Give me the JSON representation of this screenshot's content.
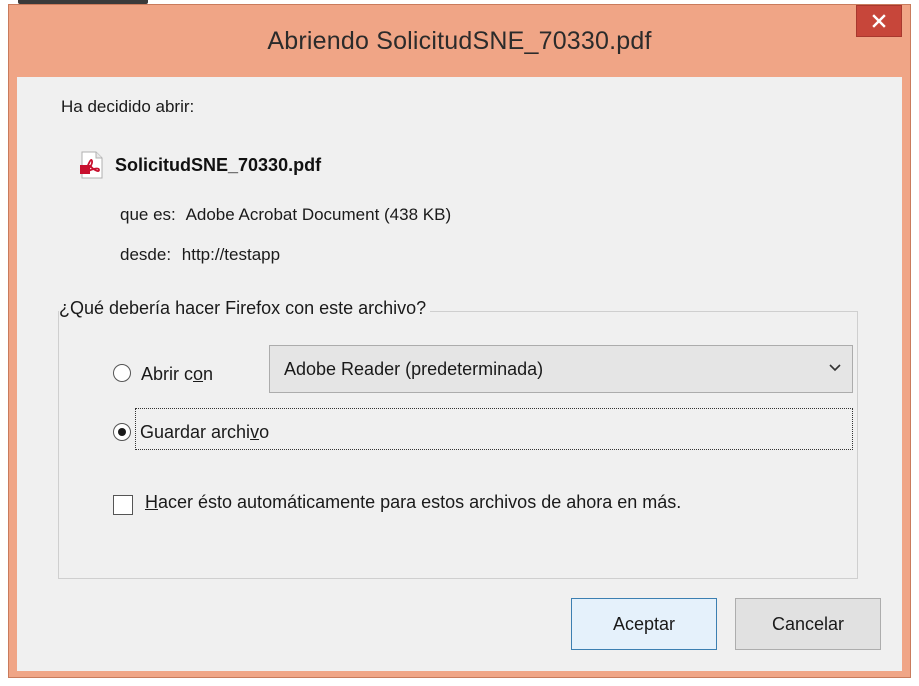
{
  "dialog": {
    "title": "Abriendo SolicitudSNE_70330.pdf",
    "close_label": "×"
  },
  "intro": {
    "decided_text": "Ha decidido abrir:"
  },
  "file": {
    "name": "SolicitudSNE_70330.pdf",
    "type_key": "que es:",
    "type_value": "Adobe Acrobat Document (438 KB)",
    "from_key": "desde:",
    "from_value": "http://testapp",
    "icon": "pdf-file-icon"
  },
  "action_group": {
    "legend": "¿Qué debería hacer Firefox con este archivo?",
    "open_with": {
      "label_pre": "Abrir c",
      "label_accel": "o",
      "label_post": "n",
      "selected": false,
      "app_value": "Adobe Reader  (predeterminada)"
    },
    "save_file": {
      "label_pre": "Guardar archi",
      "label_accel": "v",
      "label_post": "o",
      "selected": true
    },
    "auto": {
      "label_accel": "H",
      "label_post": "acer ésto automáticamente para estos archivos de ahora en más.",
      "checked": false
    }
  },
  "buttons": {
    "ok_label": "Aceptar",
    "cancel_label": "Cancelar"
  },
  "colors": {
    "title_bar": "#f0a586",
    "close_button": "#c7463a",
    "client_bg": "#f0f0f0",
    "pdf_red": "#c8102e"
  }
}
